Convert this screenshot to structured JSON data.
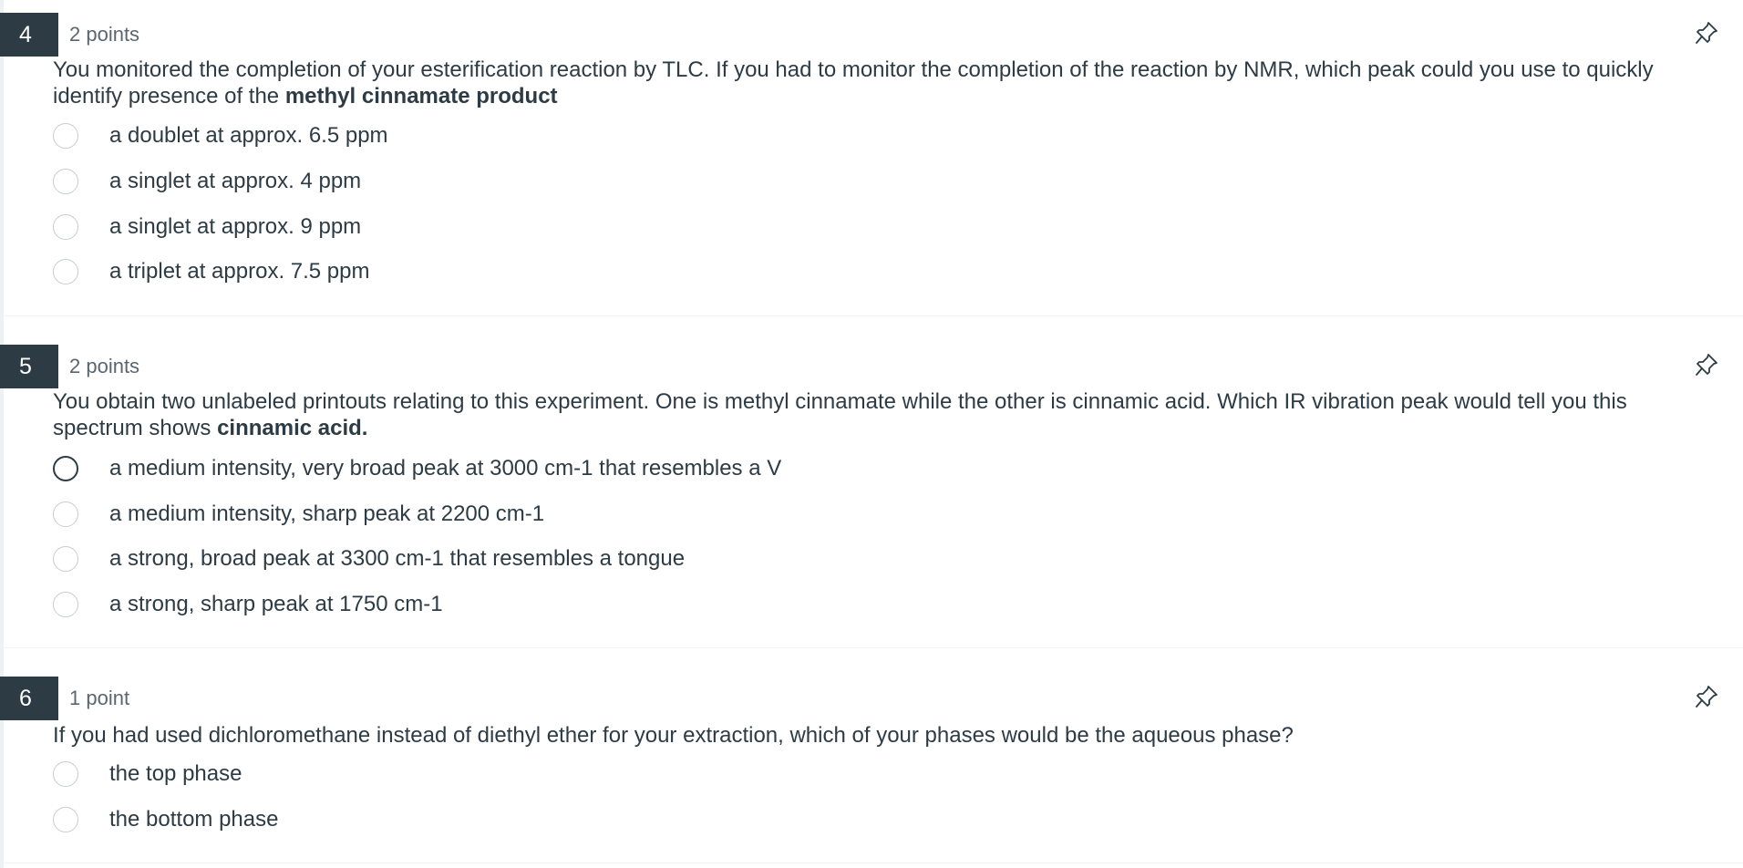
{
  "questions": [
    {
      "number": "4",
      "points": "2 points",
      "text_before": "You monitored the completion of your esterification reaction by TLC. If you had to monitor the completion of the reaction by NMR, which peak could you use to quickly identify presence of the ",
      "text_bold": "methyl cinnamate product",
      "answers": [
        "a doublet at approx. 6.5 ppm",
        "a singlet at approx. 4 ppm",
        "a singlet at approx. 9 ppm",
        "a triplet at approx. 7.5 ppm"
      ]
    },
    {
      "number": "5",
      "points": "2 points",
      "text_before": "You obtain two unlabeled printouts relating to this experiment. One is methyl cinnamate while the other is cinnamic acid. Which IR vibration peak would tell you this spectrum shows ",
      "text_bold": "cinnamic acid.",
      "answers": [
        "a medium intensity, very broad peak at 3000 cm-1 that resembles a V",
        "a medium intensity, sharp peak at 2200 cm-1",
        "a strong, broad peak at 3300 cm-1 that resembles a tongue",
        "a strong, sharp peak at 1750 cm-1"
      ]
    },
    {
      "number": "6",
      "points": "1 point",
      "text_before": "If you had used dichloromethane instead of diethyl ether for your extraction, which of your phases would be the aqueous phase?",
      "text_bold": "",
      "answers": [
        "the top phase",
        "the bottom phase"
      ]
    }
  ],
  "icons": {
    "pin": "pin-icon"
  },
  "colors": {
    "number_badge": "#2d3b45",
    "text": "#2d3b45",
    "radio_border": "#c7cdd1"
  }
}
